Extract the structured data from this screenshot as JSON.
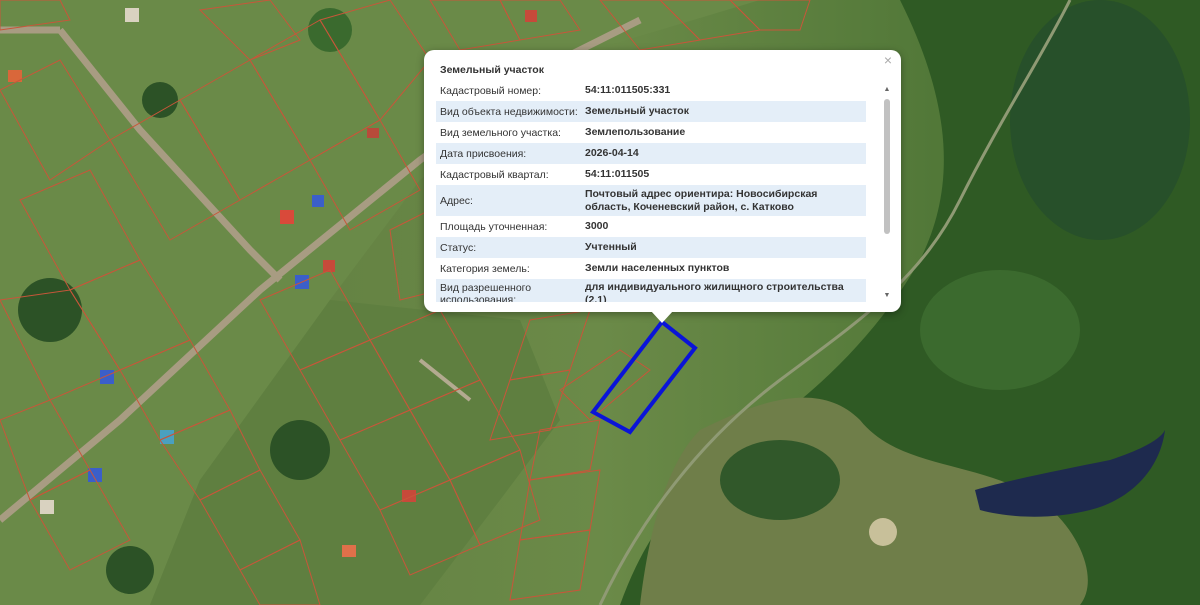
{
  "popup": {
    "title": "Земельный участок",
    "close_glyph": "×",
    "fields": [
      {
        "label": "Кадастровый номер:",
        "value": "54:11:011505:331"
      },
      {
        "label": "Вид объекта недвижимости:",
        "value": "Земельный участок"
      },
      {
        "label": "Вид земельного участка:",
        "value": "Землепользование"
      },
      {
        "label": "Дата присвоения:",
        "value": "2026-04-14"
      },
      {
        "label": "Кадастровый квартал:",
        "value": "54:11:011505"
      },
      {
        "label": "Адрес:",
        "value": "Почтовый адрес ориентира: Новосибирская область, Коченевский район, с. Катково"
      },
      {
        "label": "Площадь уточненная:",
        "value": "3000"
      },
      {
        "label": "Статус:",
        "value": "Учтенный"
      },
      {
        "label": "Категория земель:",
        "value": "Земли населенных пунктов"
      },
      {
        "label": "Вид разрешенного использования:",
        "value": "для индивидуального жилищного строительства (2.1)"
      }
    ],
    "scroll_up_glyph": "▲",
    "scroll_down_glyph": "▼"
  },
  "map": {
    "parcel_border_color": "#c8563a",
    "selected_parcel_color": "#0a14d8"
  }
}
